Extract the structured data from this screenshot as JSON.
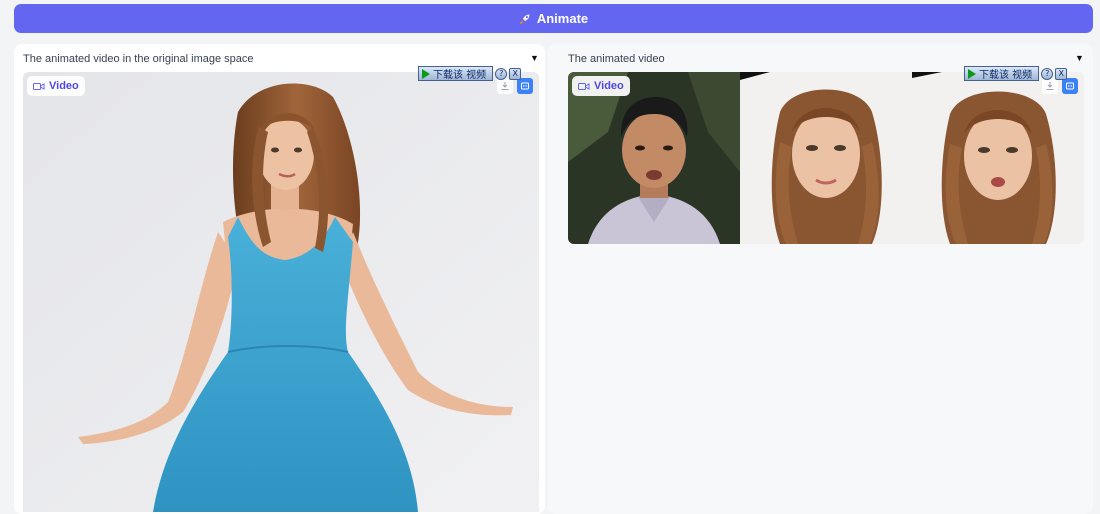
{
  "toolbar": {
    "animate_label": "Animate"
  },
  "left_panel": {
    "label": "The animated video in the original image space",
    "badge": "Video",
    "download_button": "下载该 视频",
    "help_symbol": "?",
    "close_symbol": "X"
  },
  "right_panel": {
    "label": "The animated video",
    "badge": "Video",
    "download_button": "下载该 视频",
    "help_symbol": "?",
    "close_symbol": "X"
  },
  "colors": {
    "accent": "#6366f1",
    "badge_text": "#4f46e5",
    "dress": "#3fa3cf"
  },
  "icons": {
    "animate": "rocket-icon",
    "video": "video-camera-icon",
    "download": "download-icon",
    "share": "share-icon",
    "caret": "caret-down-icon"
  }
}
